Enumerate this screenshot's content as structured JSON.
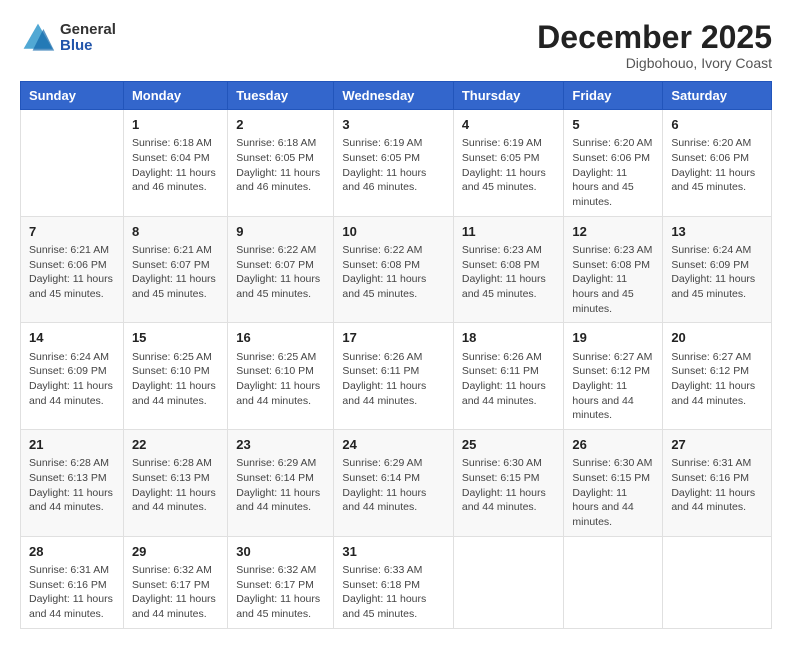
{
  "header": {
    "logo_general": "General",
    "logo_blue": "Blue",
    "title": "December 2025",
    "subtitle": "Digbohouo, Ivory Coast"
  },
  "days_of_week": [
    "Sunday",
    "Monday",
    "Tuesday",
    "Wednesday",
    "Thursday",
    "Friday",
    "Saturday"
  ],
  "weeks": [
    [
      {
        "day": "",
        "sunrise": "",
        "sunset": "",
        "daylight": ""
      },
      {
        "day": "1",
        "sunrise": "Sunrise: 6:18 AM",
        "sunset": "Sunset: 6:04 PM",
        "daylight": "Daylight: 11 hours and 46 minutes."
      },
      {
        "day": "2",
        "sunrise": "Sunrise: 6:18 AM",
        "sunset": "Sunset: 6:05 PM",
        "daylight": "Daylight: 11 hours and 46 minutes."
      },
      {
        "day": "3",
        "sunrise": "Sunrise: 6:19 AM",
        "sunset": "Sunset: 6:05 PM",
        "daylight": "Daylight: 11 hours and 46 minutes."
      },
      {
        "day": "4",
        "sunrise": "Sunrise: 6:19 AM",
        "sunset": "Sunset: 6:05 PM",
        "daylight": "Daylight: 11 hours and 45 minutes."
      },
      {
        "day": "5",
        "sunrise": "Sunrise: 6:20 AM",
        "sunset": "Sunset: 6:06 PM",
        "daylight": "Daylight: 11 hours and 45 minutes."
      },
      {
        "day": "6",
        "sunrise": "Sunrise: 6:20 AM",
        "sunset": "Sunset: 6:06 PM",
        "daylight": "Daylight: 11 hours and 45 minutes."
      }
    ],
    [
      {
        "day": "7",
        "sunrise": "Sunrise: 6:21 AM",
        "sunset": "Sunset: 6:06 PM",
        "daylight": "Daylight: 11 hours and 45 minutes."
      },
      {
        "day": "8",
        "sunrise": "Sunrise: 6:21 AM",
        "sunset": "Sunset: 6:07 PM",
        "daylight": "Daylight: 11 hours and 45 minutes."
      },
      {
        "day": "9",
        "sunrise": "Sunrise: 6:22 AM",
        "sunset": "Sunset: 6:07 PM",
        "daylight": "Daylight: 11 hours and 45 minutes."
      },
      {
        "day": "10",
        "sunrise": "Sunrise: 6:22 AM",
        "sunset": "Sunset: 6:08 PM",
        "daylight": "Daylight: 11 hours and 45 minutes."
      },
      {
        "day": "11",
        "sunrise": "Sunrise: 6:23 AM",
        "sunset": "Sunset: 6:08 PM",
        "daylight": "Daylight: 11 hours and 45 minutes."
      },
      {
        "day": "12",
        "sunrise": "Sunrise: 6:23 AM",
        "sunset": "Sunset: 6:08 PM",
        "daylight": "Daylight: 11 hours and 45 minutes."
      },
      {
        "day": "13",
        "sunrise": "Sunrise: 6:24 AM",
        "sunset": "Sunset: 6:09 PM",
        "daylight": "Daylight: 11 hours and 45 minutes."
      }
    ],
    [
      {
        "day": "14",
        "sunrise": "Sunrise: 6:24 AM",
        "sunset": "Sunset: 6:09 PM",
        "daylight": "Daylight: 11 hours and 44 minutes."
      },
      {
        "day": "15",
        "sunrise": "Sunrise: 6:25 AM",
        "sunset": "Sunset: 6:10 PM",
        "daylight": "Daylight: 11 hours and 44 minutes."
      },
      {
        "day": "16",
        "sunrise": "Sunrise: 6:25 AM",
        "sunset": "Sunset: 6:10 PM",
        "daylight": "Daylight: 11 hours and 44 minutes."
      },
      {
        "day": "17",
        "sunrise": "Sunrise: 6:26 AM",
        "sunset": "Sunset: 6:11 PM",
        "daylight": "Daylight: 11 hours and 44 minutes."
      },
      {
        "day": "18",
        "sunrise": "Sunrise: 6:26 AM",
        "sunset": "Sunset: 6:11 PM",
        "daylight": "Daylight: 11 hours and 44 minutes."
      },
      {
        "day": "19",
        "sunrise": "Sunrise: 6:27 AM",
        "sunset": "Sunset: 6:12 PM",
        "daylight": "Daylight: 11 hours and 44 minutes."
      },
      {
        "day": "20",
        "sunrise": "Sunrise: 6:27 AM",
        "sunset": "Sunset: 6:12 PM",
        "daylight": "Daylight: 11 hours and 44 minutes."
      }
    ],
    [
      {
        "day": "21",
        "sunrise": "Sunrise: 6:28 AM",
        "sunset": "Sunset: 6:13 PM",
        "daylight": "Daylight: 11 hours and 44 minutes."
      },
      {
        "day": "22",
        "sunrise": "Sunrise: 6:28 AM",
        "sunset": "Sunset: 6:13 PM",
        "daylight": "Daylight: 11 hours and 44 minutes."
      },
      {
        "day": "23",
        "sunrise": "Sunrise: 6:29 AM",
        "sunset": "Sunset: 6:14 PM",
        "daylight": "Daylight: 11 hours and 44 minutes."
      },
      {
        "day": "24",
        "sunrise": "Sunrise: 6:29 AM",
        "sunset": "Sunset: 6:14 PM",
        "daylight": "Daylight: 11 hours and 44 minutes."
      },
      {
        "day": "25",
        "sunrise": "Sunrise: 6:30 AM",
        "sunset": "Sunset: 6:15 PM",
        "daylight": "Daylight: 11 hours and 44 minutes."
      },
      {
        "day": "26",
        "sunrise": "Sunrise: 6:30 AM",
        "sunset": "Sunset: 6:15 PM",
        "daylight": "Daylight: 11 hours and 44 minutes."
      },
      {
        "day": "27",
        "sunrise": "Sunrise: 6:31 AM",
        "sunset": "Sunset: 6:16 PM",
        "daylight": "Daylight: 11 hours and 44 minutes."
      }
    ],
    [
      {
        "day": "28",
        "sunrise": "Sunrise: 6:31 AM",
        "sunset": "Sunset: 6:16 PM",
        "daylight": "Daylight: 11 hours and 44 minutes."
      },
      {
        "day": "29",
        "sunrise": "Sunrise: 6:32 AM",
        "sunset": "Sunset: 6:17 PM",
        "daylight": "Daylight: 11 hours and 44 minutes."
      },
      {
        "day": "30",
        "sunrise": "Sunrise: 6:32 AM",
        "sunset": "Sunset: 6:17 PM",
        "daylight": "Daylight: 11 hours and 45 minutes."
      },
      {
        "day": "31",
        "sunrise": "Sunrise: 6:33 AM",
        "sunset": "Sunset: 6:18 PM",
        "daylight": "Daylight: 11 hours and 45 minutes."
      },
      {
        "day": "",
        "sunrise": "",
        "sunset": "",
        "daylight": ""
      },
      {
        "day": "",
        "sunrise": "",
        "sunset": "",
        "daylight": ""
      },
      {
        "day": "",
        "sunrise": "",
        "sunset": "",
        "daylight": ""
      }
    ]
  ]
}
